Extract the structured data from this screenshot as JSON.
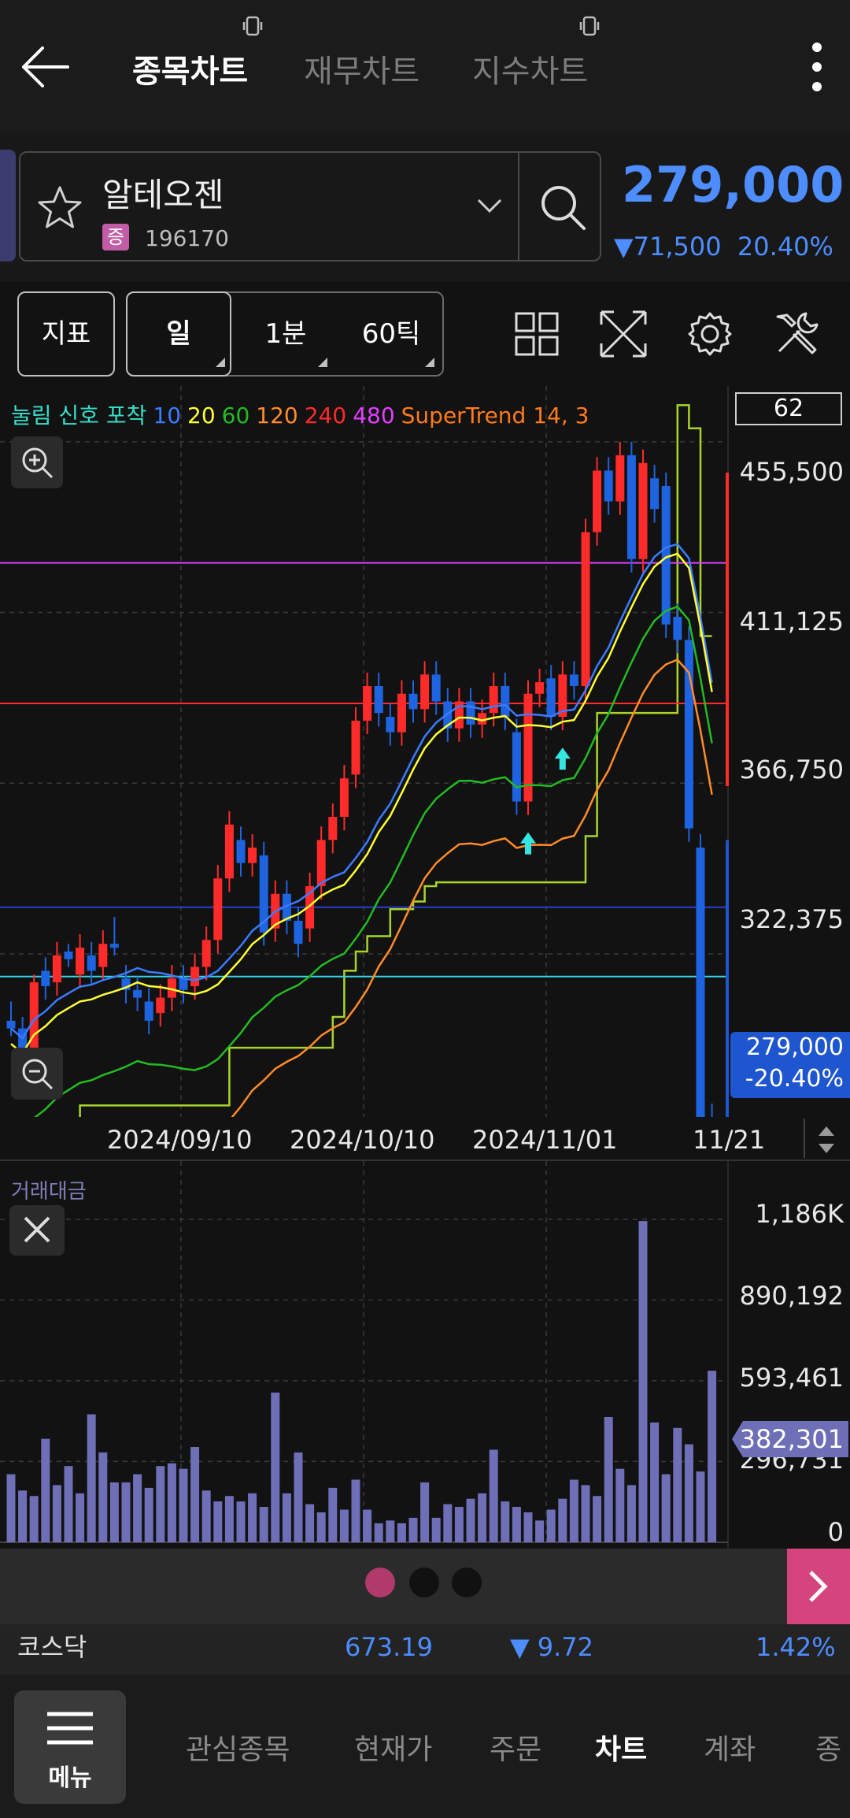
{
  "header": {
    "tabs": [
      {
        "label": "종목차트",
        "active": true
      },
      {
        "label": "재무차트",
        "active": false
      },
      {
        "label": "지수차트",
        "active": false
      }
    ]
  },
  "stock": {
    "name": "알테오젠",
    "market_badge": "증",
    "code": "196170",
    "price": "279,000",
    "change": "▼71,500",
    "change_pct": "20.40%",
    "color_down": "#4d8dff"
  },
  "toolbar": {
    "indicator_label": "지표",
    "periods": [
      "일",
      "1분",
      "60틱"
    ]
  },
  "chart_data": {
    "type": "candlestick",
    "legend": {
      "title": "눌림 신호 포착",
      "ma_periods": [
        {
          "label": "10",
          "color": "#3b7bff"
        },
        {
          "label": "20",
          "color": "#ffff33"
        },
        {
          "label": "60",
          "color": "#22bb22"
        },
        {
          "label": "120",
          "color": "#ff8c2a"
        },
        {
          "label": "240",
          "color": "#ff2a2a"
        },
        {
          "label": "480",
          "color": "#e040fb"
        }
      ],
      "supertrend": "SuperTrend 14, 3"
    },
    "visible_count": "62",
    "y_ticks": [
      "455,500",
      "411,125",
      "366,750",
      "322,375"
    ],
    "y_range": [
      280000,
      470000
    ],
    "x_ticks": [
      "2024/09/10",
      "2024/10/10",
      "2024/11/01",
      "11/21"
    ],
    "current_price": "279,000",
    "current_change": "-20.40%",
    "horizontal_lines": [
      {
        "value": 424000,
        "color": "#e040fb"
      },
      {
        "value": 387500,
        "color": "#ff2a2a"
      },
      {
        "value": 334500,
        "color": "#2a3fd0"
      },
      {
        "value": 316500,
        "color": "#35d5e6"
      },
      {
        "value": 279000,
        "color": "#ffffff"
      }
    ],
    "candles": [
      [
        305000,
        310000,
        301000,
        303000
      ],
      [
        303000,
        306000,
        292000,
        298000
      ],
      [
        290000,
        317000,
        288000,
        315000
      ],
      [
        318000,
        314000
      ],
      [
        315000,
        322000
      ],
      [
        323000,
        325000,
        319000,
        321000
      ],
      [
        317000,
        324000
      ],
      [
        322000,
        318000
      ],
      [
        319000,
        325000
      ],
      [
        325000,
        332000,
        322000,
        324000
      ],
      [
        316000,
        313000
      ],
      [
        313000,
        311000
      ],
      [
        310000,
        305000
      ],
      [
        307000,
        311000
      ],
      [
        311000,
        316000
      ],
      [
        316000,
        313000
      ],
      [
        314000,
        319000
      ],
      [
        319000,
        326000
      ],
      [
        326000,
        342000
      ],
      [
        342000,
        356000
      ],
      [
        352000,
        346000
      ],
      [
        346000,
        350000
      ],
      [
        348000,
        328000
      ],
      [
        329000,
        338000
      ],
      [
        338000,
        331000
      ],
      [
        331000,
        325000
      ],
      [
        329000,
        340000
      ],
      [
        340000,
        352000
      ],
      [
        352000,
        358000
      ],
      [
        358000,
        368000
      ],
      [
        369000,
        383000
      ],
      [
        383000,
        392000
      ],
      [
        392000,
        385000
      ],
      [
        384000,
        380000
      ],
      [
        380000,
        390000
      ],
      [
        390000,
        386000
      ],
      [
        386000,
        395000
      ],
      [
        395000,
        388000
      ],
      [
        388000,
        381000
      ],
      [
        381000,
        388000
      ],
      [
        388000,
        382000
      ],
      [
        382000,
        385000
      ],
      [
        385000,
        392000
      ],
      [
        392000,
        384000
      ],
      [
        380000,
        362000
      ],
      [
        362000,
        390000
      ],
      [
        390000,
        393000
      ],
      [
        394000,
        384000
      ],
      [
        384000,
        395000
      ],
      [
        395000,
        392000
      ],
      [
        392000,
        432000
      ],
      [
        432000,
        448000
      ],
      [
        448000,
        440000
      ],
      [
        440000,
        452000
      ],
      [
        452000,
        425000
      ],
      [
        425000,
        450000
      ],
      [
        446000,
        438000
      ],
      [
        444000,
        408000
      ],
      [
        410000,
        404000
      ],
      [
        404000,
        355000
      ],
      [
        350000,
        279000
      ],
      [
        280000,
        278000
      ]
    ],
    "supertrend_series": [
      270000,
      270000,
      270000,
      270000,
      270000,
      270000,
      283000,
      283000,
      283000,
      283000,
      283000,
      283000,
      283000,
      283000,
      283000,
      283000,
      283000,
      283000,
      283000,
      298000,
      298000,
      298000,
      298000,
      298000,
      298000,
      298000,
      298000,
      298000,
      306000,
      318000,
      323000,
      327000,
      327000,
      334000,
      334000,
      336000,
      340000,
      341000,
      341000,
      341000,
      341000,
      341000,
      341000,
      341000,
      341000,
      341000,
      341000,
      341000,
      341000,
      341000,
      353000,
      385000,
      385000,
      385000,
      385000,
      385000,
      385000,
      385000,
      465000,
      459000,
      405000,
      405000
    ],
    "markers": [
      {
        "index": 45,
        "type": "up-arrow"
      },
      {
        "index": 48,
        "type": "up-arrow"
      }
    ]
  },
  "volume": {
    "title": "거래대금",
    "y_ticks": [
      "1,186K",
      "890,192",
      "593,461",
      "296,731",
      "0"
    ],
    "y_range": [
      0,
      1186000
    ],
    "current": "382,301",
    "bar_color": "#6f6fb8",
    "values": [
      250000,
      190000,
      170000,
      380000,
      210000,
      280000,
      180000,
      470000,
      330000,
      220000,
      220000,
      250000,
      200000,
      280000,
      290000,
      270000,
      350000,
      190000,
      150000,
      170000,
      150000,
      180000,
      130000,
      550000,
      180000,
      330000,
      140000,
      110000,
      200000,
      120000,
      230000,
      120000,
      70000,
      80000,
      70000,
      90000,
      220000,
      90000,
      140000,
      130000,
      160000,
      180000,
      340000,
      150000,
      130000,
      110000,
      80000,
      120000,
      160000,
      230000,
      210000,
      170000,
      460000,
      270000,
      210000,
      1180000,
      440000,
      250000,
      420000,
      360000,
      260000,
      630000
    ]
  },
  "pager": {
    "dots": 3
  },
  "market_index": {
    "name": "코스닥",
    "value": "673.19",
    "change": "▼ 9.72",
    "pct": "1.42%"
  },
  "nav": {
    "menu_label": "메뉴",
    "items": [
      {
        "label": "관심종목",
        "active": false
      },
      {
        "label": "현재가",
        "active": false
      },
      {
        "label": "주문",
        "active": false
      },
      {
        "label": "차트",
        "active": true
      },
      {
        "label": "계좌",
        "active": false
      },
      {
        "label": "종",
        "active": false
      }
    ]
  }
}
